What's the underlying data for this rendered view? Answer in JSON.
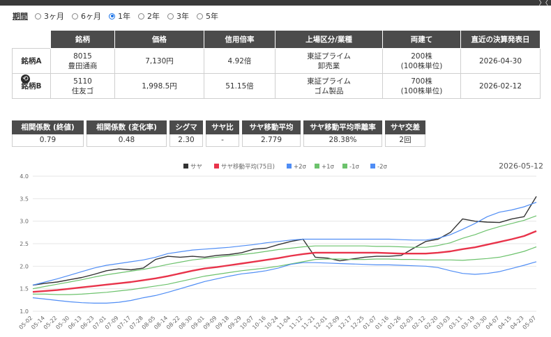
{
  "topbar": {
    "corner_text": "〉〈"
  },
  "period": {
    "label": "期間",
    "options": [
      "3ヶ月",
      "6ヶ月",
      "1年",
      "2年",
      "3年",
      "5年"
    ],
    "selected": "1年"
  },
  "stocks": {
    "headers": [
      "",
      "銘柄",
      "価格",
      "信用倍率",
      "上場区分/業種",
      "両建て",
      "直近の決算発表日"
    ],
    "rows": [
      {
        "label": "銘柄A",
        "code": "8015",
        "name": "豊田通商",
        "price": "7,130円",
        "margin_ratio": "4.92倍",
        "market": "東証プライム",
        "sector": "卸売業",
        "lots": "200株",
        "unit": "(100株単位)",
        "earnings_date": "2026-04-30"
      },
      {
        "label": "銘柄B",
        "code": "5110",
        "name": "住友ゴ",
        "price": "1,998.5円",
        "margin_ratio": "51.15倍",
        "market": "東証プライム",
        "sector": "ゴム製品",
        "lots": "700株",
        "unit": "(100株単位)",
        "earnings_date": "2026-02-12"
      }
    ],
    "swap_icon": "swap-icon"
  },
  "stats": [
    {
      "label": "相関係数 (終値)",
      "value": "0.79"
    },
    {
      "label": "相関係数 (変化率)",
      "value": "0.48"
    },
    {
      "label": "シグマ",
      "value": "2.30"
    },
    {
      "label": "サヤ比",
      "value": "-"
    },
    {
      "label": "サヤ移動平均",
      "value": "2.779"
    },
    {
      "label": "サヤ移動平均乖離率",
      "value": "28.38%"
    },
    {
      "label": "サヤ交差",
      "value": "2回"
    }
  ],
  "chart_data": {
    "type": "line",
    "date_label": "2026-05-12",
    "ylim": [
      1.0,
      4.0
    ],
    "yticks": [
      "1.0",
      "1.5",
      "2.0",
      "2.5",
      "3.0",
      "3.5",
      "4.0"
    ],
    "grid": true,
    "legend_position": "top",
    "x": [
      "05-02",
      "05-14",
      "05-22",
      "05-30",
      "06-13",
      "06-23",
      "07-01",
      "07-09",
      "07-17",
      "07-28",
      "08-05",
      "08-14",
      "08-22",
      "08-30",
      "09-01",
      "09-09",
      "09-18",
      "09-29",
      "10-07",
      "10-16",
      "10-24",
      "11-04",
      "11-12",
      "11-21",
      "12-01",
      "12-09",
      "12-17",
      "12-25",
      "01-07",
      "01-16",
      "01-26",
      "02-03",
      "02-12",
      "02-20",
      "03-03",
      "03-11",
      "03-19",
      "03-30",
      "04-07",
      "04-15",
      "04-23",
      "05-07"
    ],
    "series": [
      {
        "name": "サヤ",
        "color": "#333333",
        "values": [
          1.58,
          1.62,
          1.65,
          1.7,
          1.75,
          1.82,
          1.9,
          1.94,
          1.92,
          1.96,
          2.15,
          2.22,
          2.2,
          2.22,
          2.2,
          2.24,
          2.26,
          2.3,
          2.38,
          2.4,
          2.48,
          2.55,
          2.6,
          2.2,
          2.18,
          2.12,
          2.16,
          2.2,
          2.22,
          2.22,
          2.24,
          2.4,
          2.55,
          2.6,
          2.75,
          3.05,
          3.0,
          2.98,
          2.97,
          3.05,
          3.1,
          3.55
        ]
      },
      {
        "name": "サヤ移動平均(75日)",
        "color": "#e8334a",
        "values": [
          1.43,
          1.45,
          1.47,
          1.5,
          1.53,
          1.56,
          1.59,
          1.62,
          1.65,
          1.69,
          1.73,
          1.78,
          1.84,
          1.9,
          1.95,
          1.98,
          2.02,
          2.06,
          2.1,
          2.14,
          2.18,
          2.23,
          2.27,
          2.3,
          2.3,
          2.3,
          2.3,
          2.3,
          2.3,
          2.29,
          2.28,
          2.28,
          2.28,
          2.3,
          2.33,
          2.38,
          2.42,
          2.48,
          2.54,
          2.6,
          2.67,
          2.78
        ]
      },
      {
        "name": "+2σ",
        "color": "#4f8df5",
        "values": [
          1.58,
          1.65,
          1.72,
          1.8,
          1.88,
          1.96,
          2.02,
          2.06,
          2.1,
          2.14,
          2.2,
          2.28,
          2.32,
          2.36,
          2.38,
          2.4,
          2.42,
          2.45,
          2.48,
          2.52,
          2.55,
          2.58,
          2.6,
          2.6,
          2.6,
          2.6,
          2.6,
          2.6,
          2.6,
          2.6,
          2.59,
          2.58,
          2.58,
          2.62,
          2.7,
          2.82,
          2.95,
          3.1,
          3.2,
          3.25,
          3.32,
          3.42
        ]
      },
      {
        "name": "+1σ",
        "color": "#6cc26c",
        "values": [
          1.5,
          1.55,
          1.6,
          1.65,
          1.7,
          1.76,
          1.81,
          1.85,
          1.89,
          1.93,
          1.98,
          2.04,
          2.09,
          2.14,
          2.17,
          2.2,
          2.23,
          2.26,
          2.29,
          2.33,
          2.37,
          2.4,
          2.43,
          2.45,
          2.45,
          2.45,
          2.45,
          2.45,
          2.44,
          2.44,
          2.43,
          2.42,
          2.42,
          2.46,
          2.52,
          2.62,
          2.7,
          2.8,
          2.88,
          2.95,
          3.02,
          3.12
        ]
      },
      {
        "name": "-1σ",
        "color": "#6cc26c",
        "values": [
          1.38,
          1.38,
          1.37,
          1.37,
          1.38,
          1.4,
          1.42,
          1.45,
          1.48,
          1.52,
          1.56,
          1.6,
          1.66,
          1.72,
          1.78,
          1.82,
          1.86,
          1.9,
          1.93,
          1.96,
          2.0,
          2.05,
          2.1,
          2.15,
          2.16,
          2.16,
          2.15,
          2.15,
          2.16,
          2.16,
          2.15,
          2.15,
          2.14,
          2.14,
          2.14,
          2.13,
          2.15,
          2.17,
          2.2,
          2.26,
          2.33,
          2.43
        ]
      },
      {
        "name": "-2σ",
        "color": "#4f8df5",
        "values": [
          1.3,
          1.27,
          1.24,
          1.21,
          1.19,
          1.18,
          1.18,
          1.2,
          1.24,
          1.3,
          1.35,
          1.42,
          1.5,
          1.58,
          1.66,
          1.72,
          1.78,
          1.83,
          1.86,
          1.9,
          1.96,
          2.04,
          2.08,
          2.08,
          2.07,
          2.06,
          2.05,
          2.04,
          2.03,
          2.03,
          2.02,
          2.01,
          2.0,
          1.97,
          1.9,
          1.84,
          1.82,
          1.84,
          1.88,
          1.95,
          2.02,
          2.1
        ]
      }
    ]
  }
}
